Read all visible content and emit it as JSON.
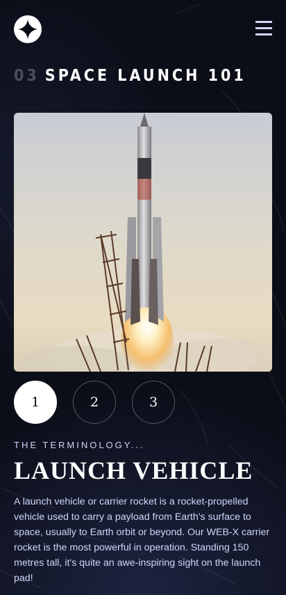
{
  "header": {
    "logo_icon": "star-icon",
    "menu_icon": "hamburger-menu-icon"
  },
  "page_heading": {
    "number": "03",
    "title": "SPACE LAUNCH 101"
  },
  "hero_image": {
    "subject": "rocket-launch"
  },
  "steps": [
    {
      "label": "1",
      "active": true
    },
    {
      "label": "2",
      "active": false
    },
    {
      "label": "3",
      "active": false
    }
  ],
  "content": {
    "eyebrow": "THE TERMINOLOGY...",
    "title": "LAUNCH VEHICLE",
    "description": "A launch vehicle or carrier rocket is a rocket-propelled vehicle used to carry a payload from Earth's surface to space, usually to Earth orbit or beyond. Our WEB-X carrier rocket is the most powerful in operation. Standing 150 metres tall, it's quite an awe-inspiring sight on the launch pad!"
  },
  "colors": {
    "background": "#0b0d17",
    "muted_text": "#d0d6f9",
    "heading_number": "#4b4e5a",
    "white": "#ffffff"
  }
}
